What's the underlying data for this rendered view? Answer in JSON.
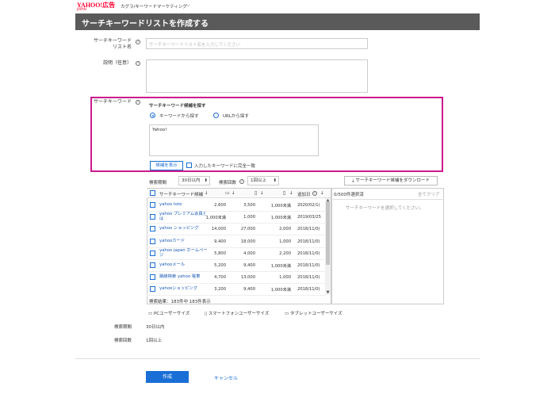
{
  "header": {
    "logo_main": "YAHOO!広告",
    "logo_sub": "JAPAN",
    "account": "カグラ/キーワードマーケティング",
    "account_chevron": "⌵"
  },
  "page": {
    "title": "サーチキーワードリストを作成する"
  },
  "form": {
    "list_name_label_1": "サーチキーワード",
    "list_name_label_2": "リスト名",
    "list_name_placeholder": "サーチキーワードリスト名を入力してください",
    "desc_label": "説明（任意）",
    "keyword_label": "サーチキーワード",
    "help_glyph": "?"
  },
  "finder": {
    "heading": "サーチキーワード候補を探す",
    "mode_keyword": "キーワードから探す",
    "mode_url": "URLから探す",
    "query_value": "Yahoo!",
    "show_button": "候補を表示",
    "exact_match": "入力したキーワードに完全一致"
  },
  "filters": {
    "period_label": "検索期間",
    "period_value": "30日以内",
    "count_label": "検索回数",
    "count_value": "1回以上",
    "download_button": "サーチキーワード候補をダウンロード",
    "updown_glyph": "⬍"
  },
  "table": {
    "headers": {
      "keyword": "サーチキーワード候補",
      "sort": "↓",
      "date": "追加日"
    },
    "rows": [
      {
        "keyword": "yahoo toto",
        "keyword2": "",
        "pc": "2,600",
        "sp": "3,500",
        "tab": "1,000未満",
        "date": "2020/02/1("
      },
      {
        "keyword": "yahoo プレミアム会員と",
        "keyword2": "は",
        "pc": "1,000未満",
        "sp": "1,000",
        "tab": "1,000未満",
        "date": "2019/03/25"
      },
      {
        "keyword": "yahoo ショッピング",
        "keyword2": "",
        "pc": "14,000",
        "sp": "27,000",
        "tab": "2,000",
        "date": "2018/11/0("
      },
      {
        "keyword": "yahooカード",
        "keyword2": "",
        "pc": "9,400",
        "sp": "18,000",
        "tab": "1,000",
        "date": "2018/11/0("
      },
      {
        "keyword": "yahoo japan ホームペー",
        "keyword2": "ジ",
        "pc": "5,800",
        "sp": "4,000",
        "tab": "2,200",
        "date": "2018/11/0("
      },
      {
        "keyword": "yahooメール",
        "keyword2": "",
        "pc": "5,200",
        "sp": "9,400",
        "tab": "1,000未満",
        "date": "2018/11/0("
      },
      {
        "keyword": "路線検索 yahoo 電車",
        "keyword2": "",
        "pc": "4,700",
        "sp": "13,000",
        "tab": "1,000",
        "date": "2018/11/0("
      },
      {
        "keyword": "yahooショッピング",
        "keyword2": "",
        "pc": "3,200",
        "sp": "9,400",
        "tab": "1,000未満",
        "date": "2018/11/0("
      }
    ],
    "result_count": "検索結果：183件中 183件表示",
    "scroll_up": "▲",
    "scroll_down": "▼"
  },
  "selected": {
    "count": "0/500件選択済",
    "clear_all": "全てクリア",
    "empty": "サーチキーワードを選択してください。"
  },
  "legend": {
    "pc": "PCユーザーサイズ",
    "sp": "スマートフォンユーザーサイズ",
    "tab": "タブレットユーザーサイズ"
  },
  "summary": {
    "period_label": "検索期間",
    "period_value": "30日以内",
    "count_label": "検索回数",
    "count_value": "1回以上"
  },
  "footer": {
    "create_button": "作成",
    "cancel_link": "キャンセル"
  }
}
